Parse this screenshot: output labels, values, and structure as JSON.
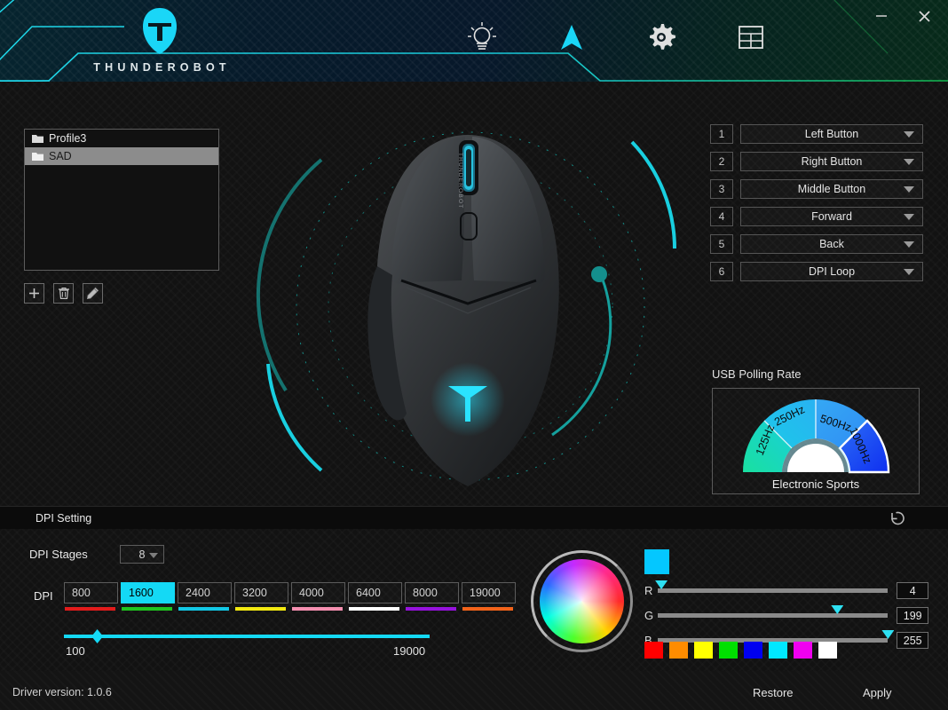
{
  "app": {
    "brand": "THUNDEROBOT",
    "logo_icon": "helmet-icon",
    "accent": "#14d9f5"
  },
  "window_controls": {
    "minimize": "–",
    "minimize_icon": "minimize-icon",
    "close": "✕",
    "close_icon": "close-icon"
  },
  "nav": {
    "items": [
      {
        "icon": "lightbulb-icon",
        "label": "Lighting",
        "active": false
      },
      {
        "icon": "cursor-arrow-icon",
        "label": "Mouse",
        "active": true
      },
      {
        "icon": "gear-icon",
        "label": "Settings",
        "active": false
      },
      {
        "icon": "table-grid-icon",
        "label": "Macro",
        "active": false
      }
    ]
  },
  "profiles": {
    "items": [
      {
        "name": "Profile3",
        "selected": false,
        "icon": "folder-icon"
      },
      {
        "name": "SAD",
        "selected": true,
        "icon": "folder-icon"
      }
    ],
    "buttons": [
      {
        "icon": "plus-icon",
        "label": "Add profile"
      },
      {
        "icon": "trash-icon",
        "label": "Delete profile"
      },
      {
        "icon": "pencil-icon",
        "label": "Rename profile"
      }
    ]
  },
  "button_assignments": {
    "rows": [
      {
        "num": "1",
        "value": "Left Button"
      },
      {
        "num": "2",
        "value": "Right Button"
      },
      {
        "num": "3",
        "value": "Middle Button"
      },
      {
        "num": "4",
        "value": "Forward"
      },
      {
        "num": "5",
        "value": "Back"
      },
      {
        "num": "6",
        "value": "DPI Loop"
      }
    ]
  },
  "polling": {
    "title": "USB Polling Rate",
    "caption": "Electronic Sports",
    "segments": [
      {
        "label": "125Hz",
        "color": "#19d9a8",
        "selected": false
      },
      {
        "label": "250Hz",
        "color": "#1ec8e8",
        "selected": false
      },
      {
        "label": "500Hz",
        "color": "#2ea4f2",
        "selected": false
      },
      {
        "label": "1000Hz",
        "color": "#1140f0",
        "selected": true
      }
    ],
    "selected": "1000Hz"
  },
  "dpi": {
    "section_title": "DPI Setting",
    "reset_icon": "reset-arrow-icon",
    "stages_label": "DPI Stages",
    "stages_value": "8",
    "dpi_label": "DPI",
    "stages": [
      {
        "value": "800",
        "color": "#e21b1b",
        "active": false
      },
      {
        "value": "1600",
        "color": "#1fc41f",
        "active": true
      },
      {
        "value": "2400",
        "color": "#12c8e6",
        "active": false
      },
      {
        "value": "3200",
        "color": "#f2e810",
        "active": false
      },
      {
        "value": "4000",
        "color": "#f58fb0",
        "active": false
      },
      {
        "value": "6400",
        "color": "#ffffff",
        "active": false
      },
      {
        "value": "8000",
        "color": "#9612dd",
        "active": false
      },
      {
        "value": "19000",
        "color": "#f2631a",
        "active": false
      }
    ],
    "slider": {
      "min": "100",
      "max": "19000",
      "position_pct": 9
    }
  },
  "color": {
    "preview_hex": "#04c7ff",
    "channels": [
      {
        "key": "R",
        "value": "4",
        "pct": 1.6
      },
      {
        "key": "G",
        "value": "199",
        "pct": 78
      },
      {
        "key": "B",
        "value": "255",
        "pct": 100
      }
    ],
    "presets": [
      "#ff0000",
      "#ff8c00",
      "#ffff00",
      "#00e000",
      "#0000f0",
      "#00e8ff",
      "#f000f0",
      "#ffffff"
    ]
  },
  "footer": {
    "driver_version": "Driver version: 1.0.6",
    "restore": "Restore",
    "apply": "Apply"
  }
}
